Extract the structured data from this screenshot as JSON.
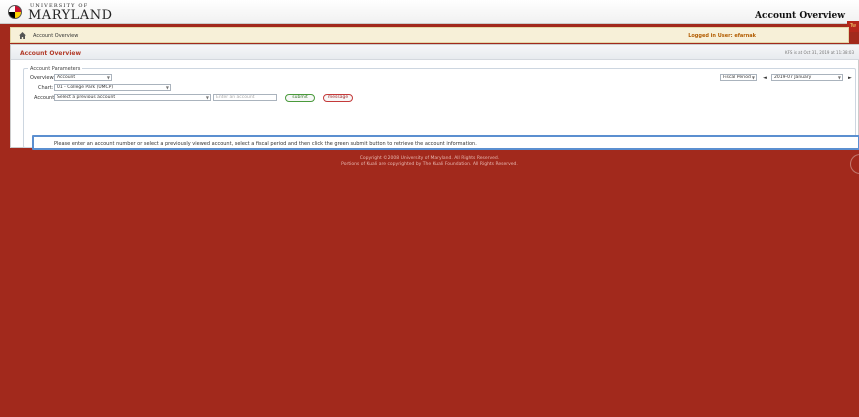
{
  "header": {
    "logo_top": "UNIVERSITY OF",
    "logo_name": "MARYLAND",
    "app_title": "Account Overview",
    "corner_tab": "Tw"
  },
  "breadcrumb_bar": {
    "breadcrumb": "Account Overview",
    "logged_in": "Logged in User: efarnak"
  },
  "panel": {
    "title": "Account Overview",
    "stamp": "KFS is at Oct 31, 2019 at 11:38:03",
    "legend": "Account Parameters",
    "overview_label": "Overview:",
    "overview_value": "Account",
    "chart_label": "Chart:",
    "chart_value": "01 - College Park (UMCP)",
    "account_label": "Account:",
    "account_value": "Select a previous account",
    "account_placeholder": "Enter an account",
    "submit_label": "submit",
    "message_label": "message",
    "fiscal_select": "Fiscal Period",
    "period_select": "2019-07 January",
    "prev_icon": "◄",
    "next_icon": "►",
    "info": "Please enter an account number or select a previously viewed account, select a fiscal period and then click the green submit button to retrieve the account information."
  },
  "footer": {
    "line1": "Copyright ©2008 University of Maryland. All Rights Reserved.",
    "line2": "Portions of Kuali are copyrighted by The Kuali Foundation. All Rights Reserved."
  }
}
